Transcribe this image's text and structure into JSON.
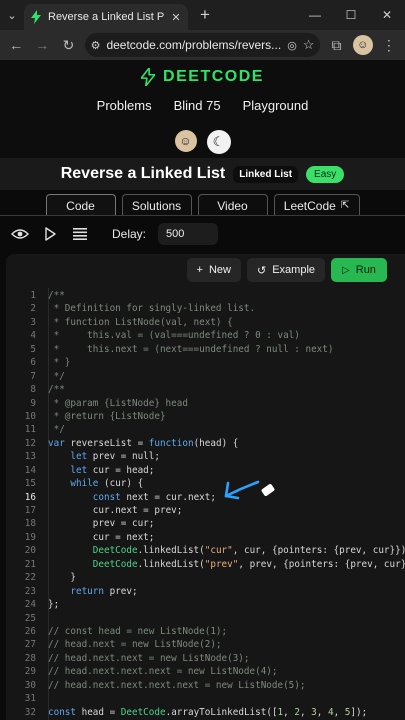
{
  "browser": {
    "tab_title": "Reverse a Linked List Problem | DeetCode",
    "url": "deetcode.com/problems/revers..."
  },
  "site": {
    "logo_text": "DEETCODE",
    "nav": [
      "Problems",
      "Blind 75",
      "Playground"
    ]
  },
  "problem": {
    "title": "Reverse a Linked List",
    "topic": "Linked List",
    "difficulty": "Easy"
  },
  "tabs": [
    "Code",
    "Solutions",
    "Video",
    "LeetCode"
  ],
  "controls": {
    "delay_label": "Delay:",
    "delay_value": "500"
  },
  "actions": {
    "new_label": "New",
    "example_label": "Example",
    "run_label": "Run"
  },
  "code_lines": [
    {
      "n": "1",
      "t": "/**",
      "k": "comment"
    },
    {
      "n": "2",
      "t": " * Definition for singly-linked list.",
      "k": "comment"
    },
    {
      "n": "3",
      "t": " * function ListNode(val, next) {",
      "k": "comment"
    },
    {
      "n": "4",
      "t": " *     this.val = (val===undefined ? 0 : val)",
      "k": "comment"
    },
    {
      "n": "5",
      "t": " *     this.next = (next===undefined ? null : next)",
      "k": "comment"
    },
    {
      "n": "6",
      "t": " * }",
      "k": "comment"
    },
    {
      "n": "7",
      "t": " */",
      "k": "comment"
    },
    {
      "n": "8",
      "t": "/**",
      "k": "comment"
    },
    {
      "n": "9",
      "t": " * @param {ListNode} head",
      "k": "comment"
    },
    {
      "n": "10",
      "t": " * @return {ListNode}",
      "k": "comment"
    },
    {
      "n": "11",
      "t": " */",
      "k": "comment"
    },
    {
      "n": "12",
      "t": "var reverseList = function(head) {",
      "k": "code"
    },
    {
      "n": "13",
      "t": "    let prev = null;",
      "k": "code"
    },
    {
      "n": "14",
      "t": "    let cur = head;",
      "k": "code"
    },
    {
      "n": "15",
      "t": "    while (cur) {",
      "k": "code"
    },
    {
      "n": "16",
      "t": "        const next = cur.next;",
      "k": "code",
      "hi": true
    },
    {
      "n": "17",
      "t": "        cur.next = prev;",
      "k": "code"
    },
    {
      "n": "18",
      "t": "        prev = cur;",
      "k": "code"
    },
    {
      "n": "19",
      "t": "        cur = next;",
      "k": "code"
    },
    {
      "n": "20",
      "t": "        DeetCode.linkedList(\"cur\", cur, {pointers: {prev, cur}})",
      "k": "code"
    },
    {
      "n": "21",
      "t": "        DeetCode.linkedList(\"prev\", prev, {pointers: {prev, cur}})",
      "k": "code"
    },
    {
      "n": "22",
      "t": "    }",
      "k": "code"
    },
    {
      "n": "23",
      "t": "    return prev;",
      "k": "code"
    },
    {
      "n": "24",
      "t": "};",
      "k": "code"
    },
    {
      "n": "25",
      "t": "",
      "k": "code"
    },
    {
      "n": "26",
      "t": "// const head = new ListNode(1);",
      "k": "comment"
    },
    {
      "n": "27",
      "t": "// head.next = new ListNode(2);",
      "k": "comment"
    },
    {
      "n": "28",
      "t": "// head.next.next = new ListNode(3);",
      "k": "comment"
    },
    {
      "n": "29",
      "t": "// head.next.next.next = new ListNode(4);",
      "k": "comment"
    },
    {
      "n": "30",
      "t": "// head.next.next.next.next = new ListNode(5);",
      "k": "comment"
    },
    {
      "n": "31",
      "t": "",
      "k": "code"
    },
    {
      "n": "32",
      "t": "const head = DeetCode.arrayToLinkedList([1, 2, 3, 4, 5]);",
      "k": "code"
    }
  ]
}
